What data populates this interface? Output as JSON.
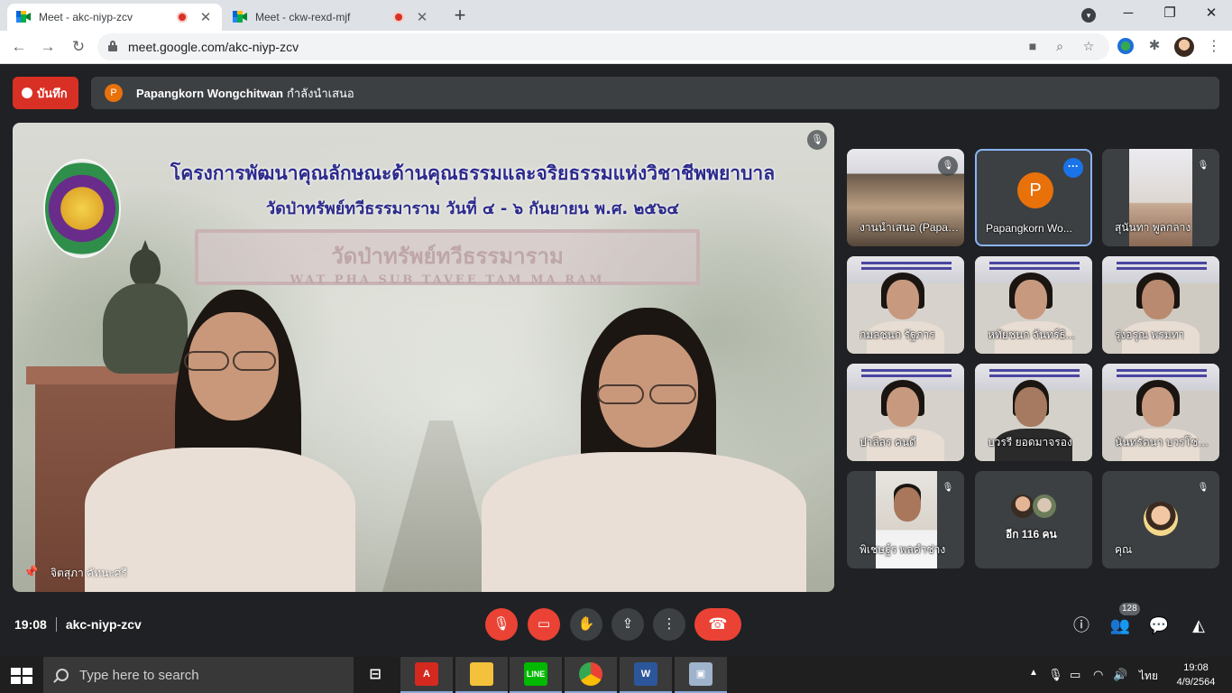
{
  "browser": {
    "tabs": [
      {
        "title": "Meet - akc-niyp-zcv",
        "active": true,
        "recording": true
      },
      {
        "title": "Meet - ckw-rexd-mjf",
        "active": false,
        "recording": true
      }
    ],
    "url": "meet.google.com/akc-niyp-zcv",
    "new_tab_icon": "+",
    "close_icon": "✕"
  },
  "meet": {
    "record_label": "บันทึก",
    "presenter_initial": "P",
    "presenter_name": "Papangkorn Wongchitwan",
    "presenter_suffix": "กำลังนำเสนอ",
    "stage": {
      "headline": "โครงการพัฒนาคุณลักษณะด้านคุณธรรมและจริยธรรมแห่งวิชาชีพพยาบาล",
      "subline": "วัดป่าทรัพย์ทวีธรรมาราม   วันที่ ๔ - ๖ กันยายน พ.ศ. ๒๕๖๔",
      "sign_thai": "วัดป่าทรัพย์ทวีธรรมาราม",
      "sign_latin": "WAT PHA SUB TAVEE TAM MA RAM",
      "speaker_name": "จิตสุภา คัทนะศรี"
    },
    "tiles": [
      {
        "label": "งานนำเสนอ (Papangko...",
        "muted": true
      },
      {
        "label": "Papangkorn Wo...",
        "initial": "P",
        "selected": true
      },
      {
        "label": "สุนันทา พูลกลาง",
        "muted": true
      },
      {
        "label": "กมลชนก รัฐภาร",
        "muted": false
      },
      {
        "label": "หทัยชนก จันทร์ธิ...",
        "muted": false
      },
      {
        "label": "รุ่งอรุณ พรมทา",
        "muted": false
      },
      {
        "label": "ปาลิสร คนดี",
        "muted": false
      },
      {
        "label": "บวรรี ยอดมาจรอง",
        "muted": false
      },
      {
        "label": "นันทรัตนา บวรโชค...",
        "muted": false
      },
      {
        "label": "พิเชษฐ์ร พลคำช่าง",
        "muted": true
      },
      {
        "label": "อีก 116 คน"
      },
      {
        "label": "คุณ",
        "muted": true
      }
    ],
    "time": "19:08",
    "meeting_code": "akc-niyp-zcv",
    "participants_count": "128"
  },
  "taskbar": {
    "search_placeholder": "Type here to search",
    "language": "ไทย",
    "clock_time": "19:08",
    "clock_date": "4/9/2564"
  },
  "colors": {
    "record_red": "#d93025",
    "end_call_red": "#ea4335",
    "presenter_orange": "#e8710a",
    "selected_outline": "#8ab4f8"
  }
}
